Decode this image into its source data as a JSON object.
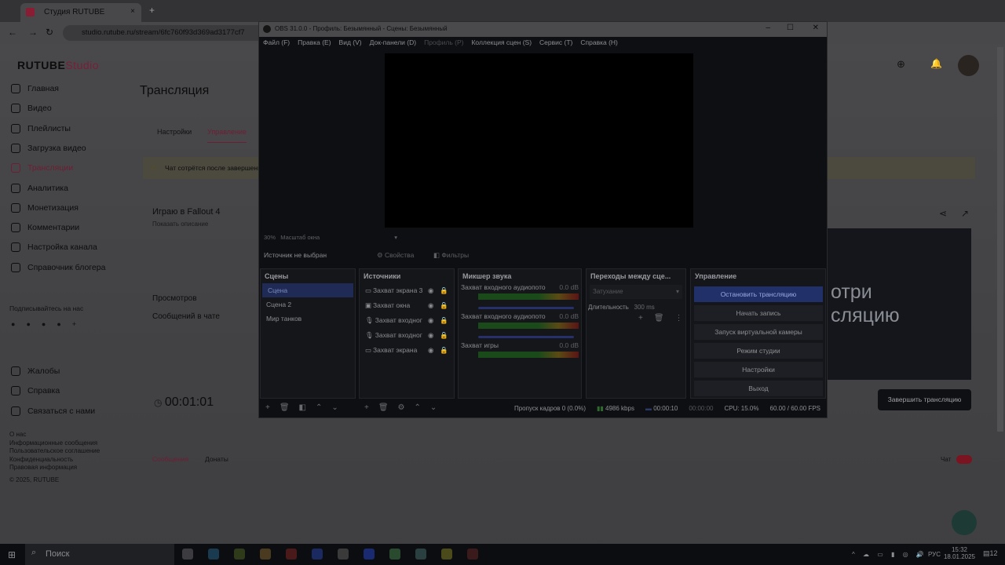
{
  "browser": {
    "tab_title": "Студия RUTUBE",
    "url": "studio.rutube.ru/stream/6fc760f93d369ad3177cf7"
  },
  "rutube": {
    "logo": "RUTUBE",
    "logo_suffix": "Studio",
    "page_title": "Трансляция",
    "sidebar": [
      "Главная",
      "Видео",
      "Плейлисты",
      "Загрузка видео",
      "Трансляции",
      "Аналитика",
      "Монетизация",
      "Комментарии",
      "Настройка канала",
      "Справочник блогера"
    ],
    "subscribe": "Подписывайтесь на нас",
    "social": [
      "vk",
      "ok",
      "tg",
      "viber",
      "+"
    ],
    "bottom_nav": [
      "Жалобы",
      "Справка",
      "Связаться с нами"
    ],
    "footer": [
      "О нас",
      "Информационные сообщения",
      "Пользовательское соглашение",
      "Конфиденциальность",
      "Правовая информация",
      "© 2025, RUTUBE"
    ],
    "tabs": [
      "Настройки",
      "Управление"
    ],
    "warning": "Чат сотрётся после завершения",
    "stream_title": "Играю в Fallout 4",
    "show_description": "Показать описание",
    "stats": [
      "Просмотров",
      "Сообщений в чате"
    ],
    "timer": "00:01:01",
    "player_text": "отри\nсляцию",
    "end_button": "Завершить трансляцию",
    "chat_tabs": [
      "Сообщения",
      "Донаты"
    ],
    "chat_toggle": "Чат"
  },
  "obs": {
    "title": "OBS 31.0.0 - Профиль: Безымянный - Сцены: Безымянный",
    "menu": [
      "Файл (F)",
      "Правка (E)",
      "Вид (V)",
      "Док-панели (D)",
      "Профиль (P)",
      "Коллекция сцен (S)",
      "Сервис (T)",
      "Справка (H)"
    ],
    "zoom": "30%",
    "zoom_label": "Масштаб окна",
    "no_source": "Источник не выбран",
    "properties": "Свойства",
    "filters": "Фильтры",
    "scenes_title": "Сцены",
    "scenes": [
      "Сцена",
      "Сцена 2",
      "Мир танков"
    ],
    "sources_title": "Источники",
    "sources": [
      "Захват экрана 3",
      "Захват окна",
      "Захват входног",
      "Захват входног",
      "Захват экрана"
    ],
    "mixer_title": "Микшер звука",
    "mixer": [
      {
        "name": "Захват входного аудиопото",
        "db": "0.0 dB"
      },
      {
        "name": "Захват входного аудиопото",
        "db": "0.0 dB"
      },
      {
        "name": "Захват игры",
        "db": "0.0 dB"
      }
    ],
    "transitions_title": "Переходы между сце...",
    "transition": "Затухание",
    "duration_label": "Длительность",
    "duration": "300 ms",
    "controls_title": "Управление",
    "controls": [
      "Остановить трансляцию",
      "Начать запись",
      "Запуск виртуальной камеры",
      "Режим студии",
      "Настройки",
      "Выход"
    ],
    "status": {
      "dropped": "Пропуск кадров 0 (0.0%)",
      "bitrate": "4986 kbps",
      "stream_time": "00:00:10",
      "rec_time": "00:00:00",
      "cpu": "CPU: 15.0%",
      "fps": "60.00 / 60.00 FPS"
    }
  },
  "taskbar": {
    "search": "Поиск",
    "lang": "РУС",
    "time": "15:32",
    "date": "18.01.2025",
    "notifications": "12"
  }
}
